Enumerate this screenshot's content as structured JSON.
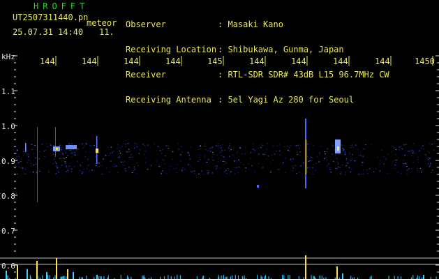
{
  "header": {
    "brand": "HROFFT",
    "filename": "UT2507311440.pn",
    "file_type": "meteor",
    "datetime": "25.07.31 14:40",
    "count": "11.",
    "fields": [
      {
        "label": "Observer",
        "value": ": Masaki Kano"
      },
      {
        "label": "Receiving Location",
        "value": ": Shibukawa, Gunma, Japan"
      },
      {
        "label": "Receiver",
        "value": ": RTL-SDR SDR# 43dB L15 96.7MHz CW"
      },
      {
        "label": "Receiving Antenna",
        "value": ": 5el Yagi Az 280 for Seoul"
      }
    ]
  },
  "axes": {
    "y_unit": "kHz",
    "y_ticks": [
      "1.1",
      "1.0",
      "0.9",
      "0.8",
      "0.7",
      "0.6"
    ],
    "time_ticks": [
      "144",
      "144",
      "144",
      "144",
      "145",
      "144",
      "144",
      "144",
      "144",
      "1450"
    ]
  },
  "colors": {
    "header_green": "#2bd62b",
    "header_yellow": "#e8e85a",
    "axis_text": "#e6e6e6",
    "tick_marks": "#e8e85a",
    "echo_blue": "#3a5cff",
    "echo_hot": "#ffe14d",
    "background": "#000000"
  }
}
